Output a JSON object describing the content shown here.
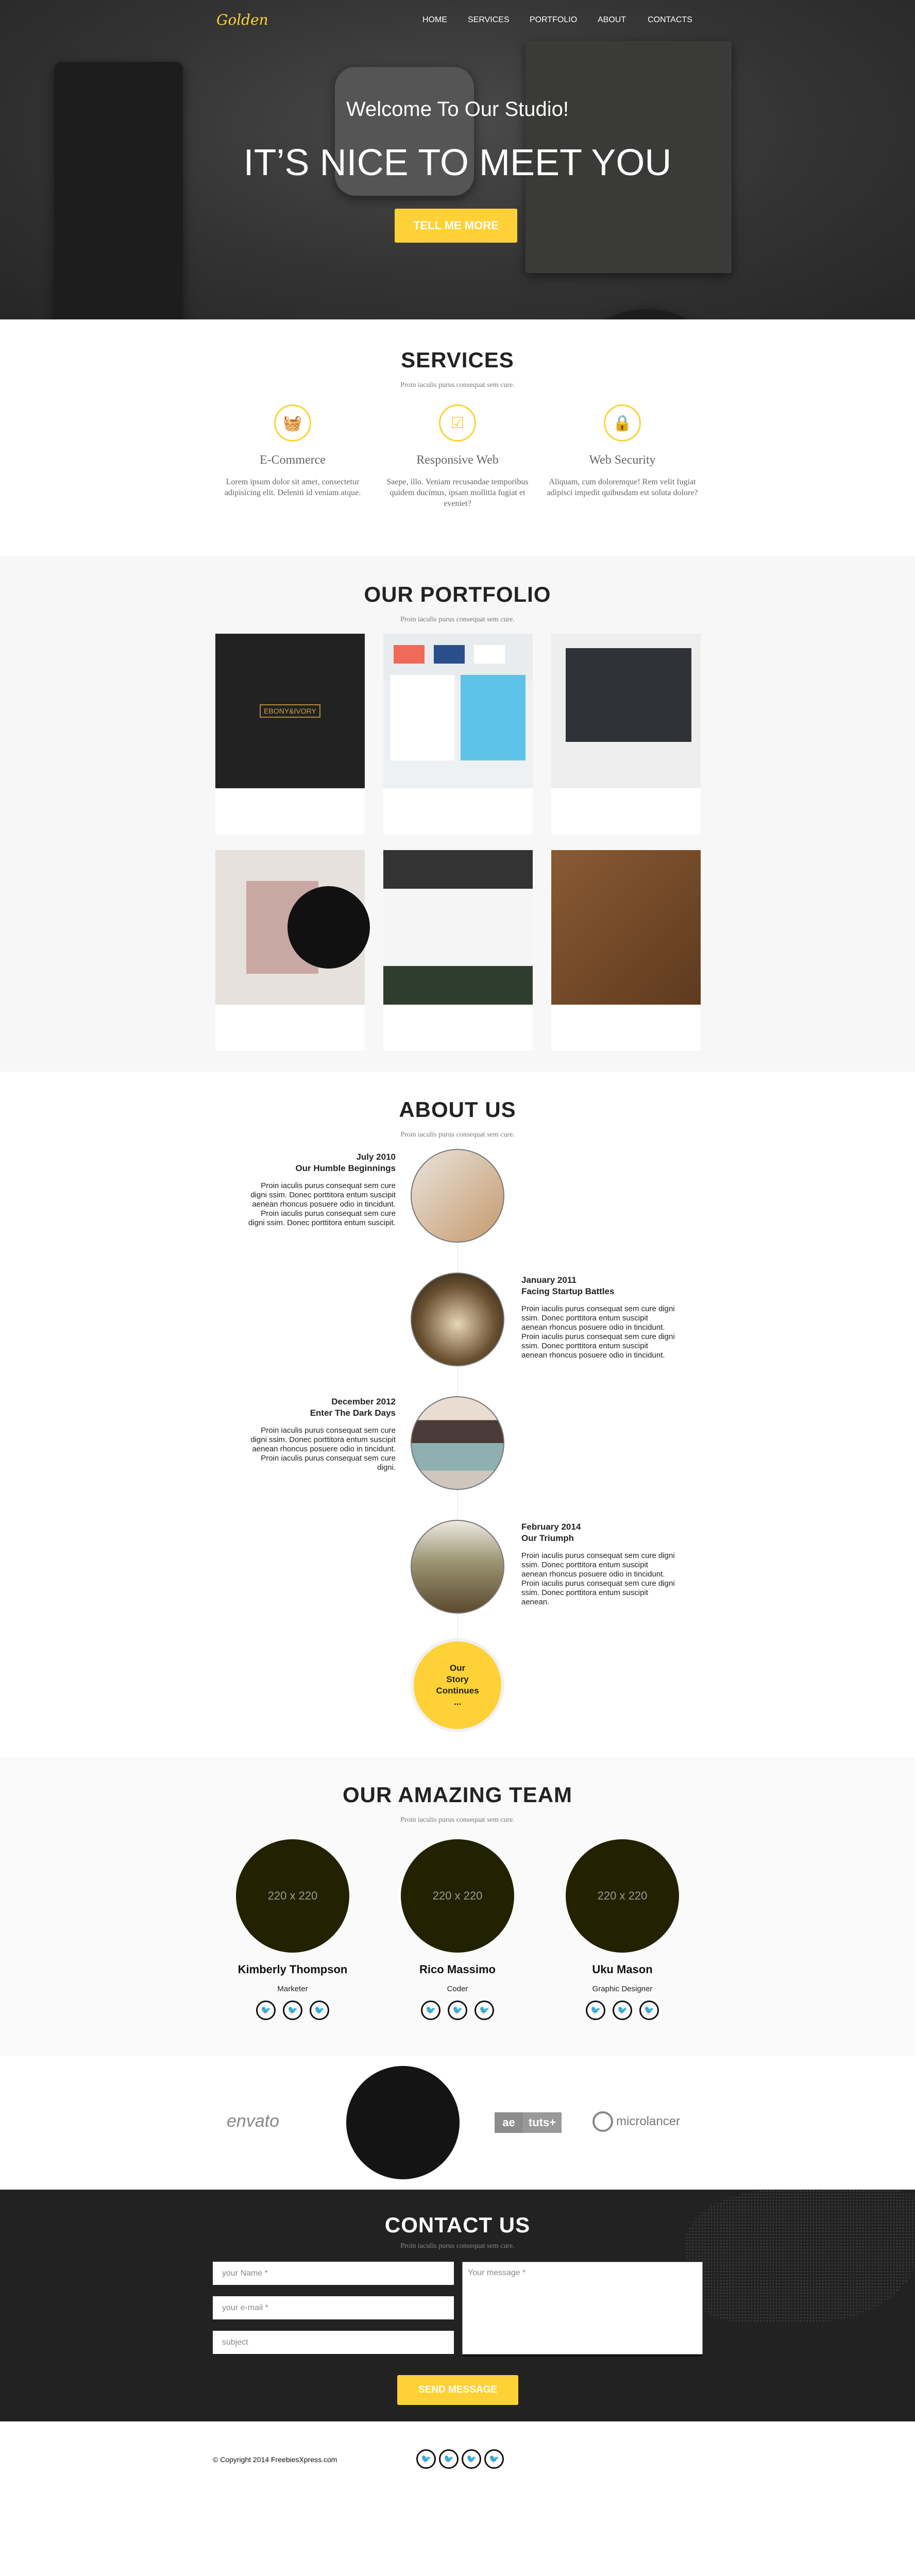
{
  "nav": {
    "logo": "Golden",
    "items": [
      "HOME",
      "SERVICES",
      "PORTFOLIO",
      "ABOUT",
      "CONTACTS"
    ]
  },
  "hero": {
    "welcome": "Welcome To Our Studio!",
    "headline": "IT’S NICE TO MEET YOU",
    "cta": "TELL ME MORE"
  },
  "services": {
    "title": "SERVICES",
    "subtitle": "Proin iaculis purus consequat sem cure.",
    "items": [
      {
        "icon": "shopping-basket-icon",
        "glyph": "🧺",
        "title": "E-Commerce",
        "text": "Lorem ipsum dolor sit amet, consectetur adipisicing elit. Deleniti id veniam atque."
      },
      {
        "icon": "tablet-check-icon",
        "glyph": "☑",
        "title": "Responsive Web",
        "text": "Saepe, illo. Veniam recusandae temporibus quidem ducimus, ipsam mollitia fugiat et eveniet?"
      },
      {
        "icon": "lock-icon",
        "glyph": "🔒",
        "title": "Web Security",
        "text": "Aliquam, cum doloremque! Rem velit fugiat adipisci impedit quibusdam est soluta dolore?"
      }
    ]
  },
  "portfolio": {
    "title": "OUR PORTFOLIO",
    "subtitle": "Proin iaculis purus consequat sem cure.",
    "logo_text": "EBONY&IVORY"
  },
  "about": {
    "title": "ABOUT US",
    "subtitle": "Proin iaculis purus consequat sem cure.",
    "items": [
      {
        "date": "July 2010",
        "heading": "Our Humble Beginnings",
        "text": "Proin iaculis purus consequat sem cure digni ssim. Donec porttitora entum suscipit aenean rhoncus posuere odio in tincidunt. Proin iaculis purus consequat sem cure digni ssim. Donec porttitora entum suscipit."
      },
      {
        "date": "January 2011",
        "heading": "Facing Startup Battles",
        "text": "Proin iaculis purus consequat sem cure digni ssim. Donec porttitora entum suscipit aenean rhoncus posuere odio in tincidunt. Proin iaculis purus consequat sem cure digni ssim. Donec porttitora entum suscipit aenean rhoncus posuere odio in tincidunt."
      },
      {
        "date": "December 2012",
        "heading": "Enter The Dark Days",
        "text": "Proin iaculis purus consequat sem cure digni ssim. Donec porttitora entum suscipit aenean rhoncus posuere odio in tincidunt. Proin iaculis purus consequat sem cure digni."
      },
      {
        "date": "February 2014",
        "heading": "Our Triumph",
        "text": "Proin iaculis purus consequat sem cure digni ssim. Donec porttitora entum suscipit aenean rhoncus posuere odio in tincidunt. Proin iaculis purus consequat sem cure digni ssim. Donec porttitora entum suscipit aenean."
      }
    ],
    "continues": [
      "Our",
      "Story",
      "Continues",
      "..."
    ]
  },
  "team": {
    "title": "OUR AMAZING TEAM",
    "subtitle": "Proin iaculis purus consequat sem cure.",
    "members": [
      {
        "placeholder": "220 x 220",
        "name": "Kimberly Thompson",
        "role": "Marketer"
      },
      {
        "placeholder": "220 x 220",
        "name": "Rico Massimo",
        "role": "Coder"
      },
      {
        "placeholder": "220 x 220",
        "name": "Uku Mason",
        "role": "Graphic Designer"
      }
    ]
  },
  "clients": {
    "envato": "envato",
    "tuts_ae": "ae",
    "tuts": "tuts+",
    "microlancer": "microlancer"
  },
  "contact": {
    "title": "CONTACT US",
    "subtitle": "Proin iaculis purus consequat sem cure.",
    "name_placeholder": "your Name *",
    "email_placeholder": "your e-mail *",
    "subject_placeholder": "subject",
    "message_placeholder": "Your message *",
    "send": "SEND MESSAGE"
  },
  "footer": {
    "copyright": "© Copyright 2014 FreebiesXpress.com"
  },
  "colors": {
    "accent": "#fed136",
    "dark": "#222222"
  }
}
